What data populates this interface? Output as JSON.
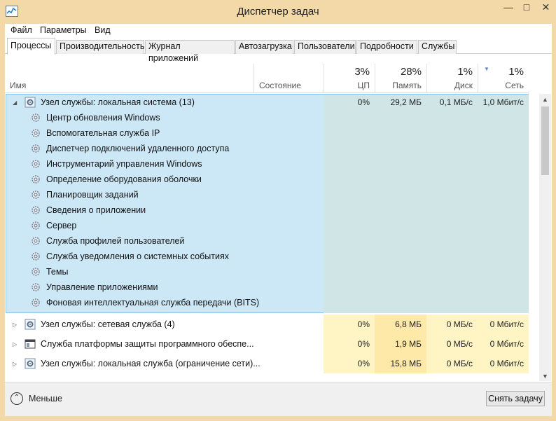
{
  "window": {
    "title": "Диспетчер задач"
  },
  "menu": {
    "items": [
      "Файл",
      "Параметры",
      "Вид"
    ]
  },
  "tabs": [
    "Процессы",
    "Производительность",
    "Журнал приложений",
    "Автозагрузка",
    "Пользователи",
    "Подробности",
    "Службы"
  ],
  "columns": {
    "name": "Имя",
    "state": "Состояние",
    "cpu": {
      "pct": "3%",
      "label": "ЦП"
    },
    "memory": {
      "pct": "28%",
      "label": "Память"
    },
    "disk": {
      "pct": "1%",
      "label": "Диск"
    },
    "network": {
      "pct": "1%",
      "label": "Сеть"
    }
  },
  "group": {
    "name": "Узел службы: локальная система (13)",
    "cpu": "0%",
    "memory": "29,2 МБ",
    "disk": "0,1 МБ/с",
    "network": "1,0 Мбит/с",
    "children": [
      "Центр обновления Windows",
      "Вспомогательная служба IP",
      "Диспетчер подключений удаленного доступа",
      "Инструментарий управления Windows",
      "Определение оборудования оболочки",
      "Планировщик заданий",
      "Сведения о приложении",
      "Сервер",
      "Служба профилей пользователей",
      "Служба уведомления о системных событиях",
      "Темы",
      "Управление приложениями",
      "Фоновая интеллектуальная служба передачи (BITS)"
    ]
  },
  "processes": [
    {
      "name": "Узел службы: сетевая служба (4)",
      "cpu": "0%",
      "memory": "6,8 МБ",
      "disk": "0 МБ/с",
      "network": "0 Мбит/с",
      "icon": "gear-icon"
    },
    {
      "name": "Служба платформы защиты программного обеспе...",
      "cpu": "0%",
      "memory": "1,9 МБ",
      "disk": "0 МБ/с",
      "network": "0 Мбит/с",
      "icon": "app-window-icon"
    },
    {
      "name": "Узел службы: локальная служба (ограничение сети)...",
      "cpu": "0%",
      "memory": "15,8 МБ",
      "disk": "0 МБ/с",
      "network": "0 Мбит/с",
      "icon": "gear-icon"
    }
  ],
  "footer": {
    "fewer_label": "Меньше",
    "end_task_label": "Снять задачу"
  }
}
